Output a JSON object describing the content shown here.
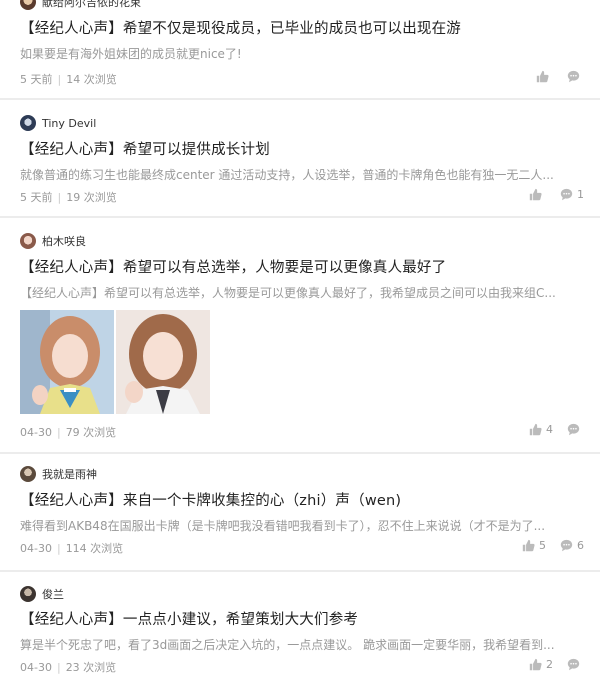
{
  "posts": [
    {
      "author": "献给阿尔吉侬的花束",
      "title": "【经纪人心声】希望不仅是现役成员，已毕业的成员也可以出现在游",
      "excerpt": "如果要是有海外姐妹团的成员就更nice了!",
      "date": "5 天前",
      "views": "14 次浏览",
      "likes": "",
      "comments": ""
    },
    {
      "author": "Tiny Devil",
      "title": "【经纪人心声】希望可以提供成长计划",
      "excerpt": "就像普通的练习生也能最终成center 通过活动支持，人设选举，普通的卡牌角色也能有独一无二人...",
      "date": "5 天前",
      "views": "19 次浏览",
      "likes": "",
      "comments": "1"
    },
    {
      "author": "柏木咲良",
      "title": "【经纪人心声】希望可以有总选举，人物要是可以更像真人最好了",
      "excerpt": "【经纪人心声】希望可以有总选举，人物要是可以更像真人最好了，我希望成员之间可以由我来组C...",
      "date": "04-30",
      "views": "79 次浏览",
      "likes": "4",
      "comments": ""
    },
    {
      "author": "我就是雨神",
      "title": "【经纪人心声】来自一个卡牌收集控的心（zhi）声（wen)",
      "excerpt": "难得看到AKB48在国服出卡牌（是卡牌吧我没看错吧我看到卡了），忍不住上来说说（才不是为了...",
      "date": "04-30",
      "views": "114 次浏览",
      "likes": "5",
      "comments": "6"
    },
    {
      "author": "俊兰",
      "title": "【经纪人心声】一点点小建议，希望策划大大们参考",
      "excerpt": "算是半个死忠了吧，看了3d画面之后决定入坑的，一点点建议。 跪求画面一定要华丽，我希望看到...",
      "date": "04-30",
      "views": "23 次浏览",
      "likes": "2",
      "comments": ""
    }
  ],
  "colors": {
    "title": "#222222",
    "meta": "#999999",
    "divider": "#ececec",
    "icon": "#bbbbbb"
  },
  "icons": [
    "thumbs-up-icon",
    "comment-icon"
  ]
}
